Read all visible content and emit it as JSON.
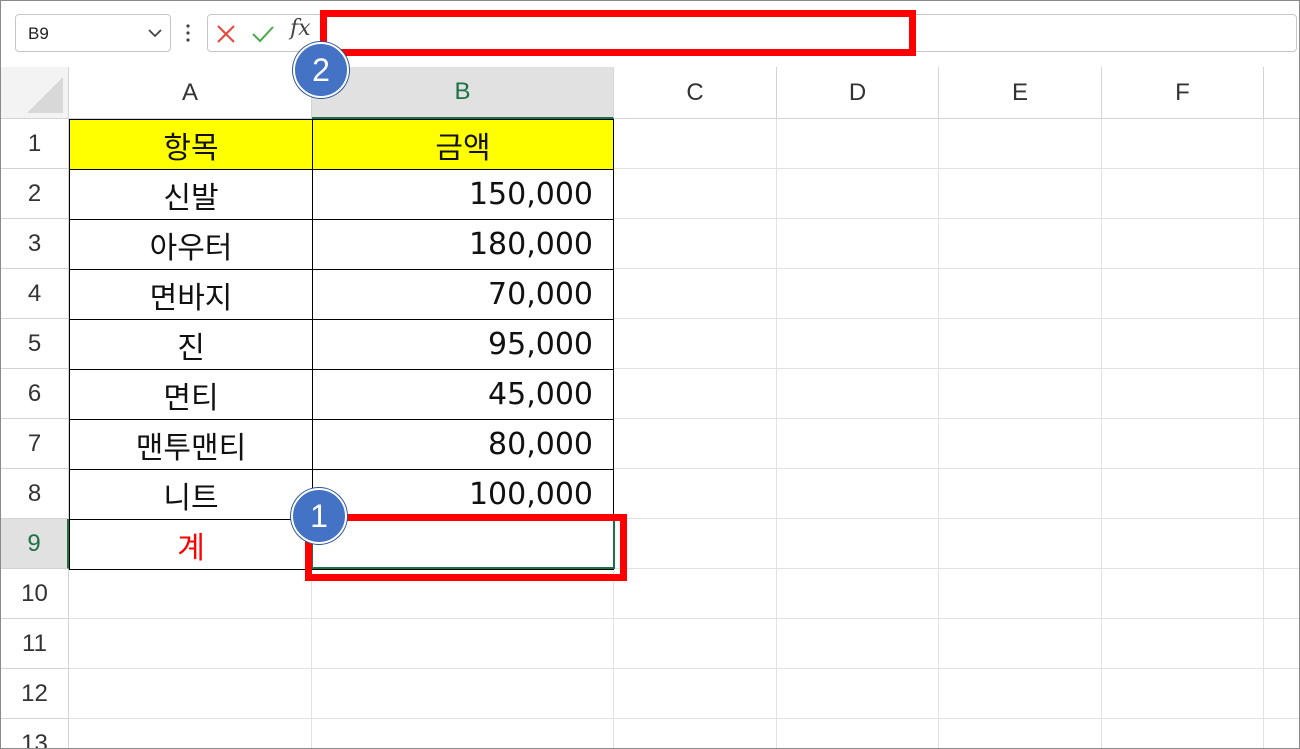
{
  "formula_bar": {
    "name_box": "B9",
    "fx_label": "fx",
    "formula": ""
  },
  "columns": [
    "A",
    "B",
    "C",
    "D",
    "E",
    "F"
  ],
  "active_column": "B",
  "rows": [
    "1",
    "2",
    "3",
    "4",
    "5",
    "6",
    "7",
    "8",
    "9",
    "10",
    "11",
    "12",
    "13"
  ],
  "active_row": "9",
  "table": {
    "header": {
      "item": "항목",
      "amount": "금액"
    },
    "rows": [
      {
        "item": "신발",
        "amount": "150,000"
      },
      {
        "item": "아우터",
        "amount": "180,000"
      },
      {
        "item": "면바지",
        "amount": "70,000"
      },
      {
        "item": "진",
        "amount": "95,000"
      },
      {
        "item": "면티",
        "amount": "45,000"
      },
      {
        "item": "맨투맨티",
        "amount": "80,000"
      },
      {
        "item": "니트",
        "amount": "100,000"
      }
    ],
    "total": {
      "item": "계",
      "amount": ""
    }
  },
  "annotations": {
    "badge1": "1",
    "badge2": "2"
  },
  "colors": {
    "header_fill": "#ffff00",
    "total_text": "#ff0000",
    "highlight": "#ff0000",
    "badge": "#4472c4",
    "active_green": "#1e7145"
  },
  "icons": [
    "chevron-down-icon",
    "more-options-icon",
    "cancel-icon",
    "enter-icon",
    "fx-icon"
  ]
}
